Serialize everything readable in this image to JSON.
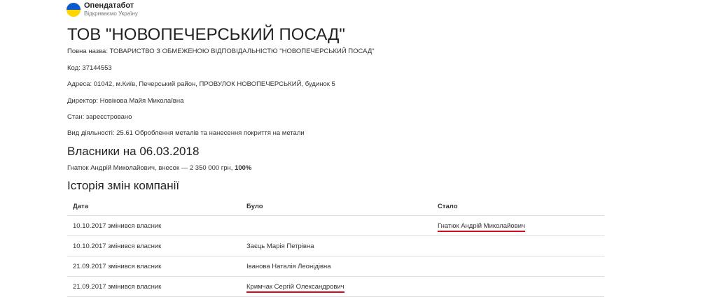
{
  "brand": {
    "name": "Опендатабот",
    "tagline": "Відкриваємо Україну"
  },
  "company": {
    "title": "ТОВ \"НОВОПЕЧЕРСЬКИЙ ПОСАД\"",
    "full_name": "Повна назва: ТОВАРИСТВО З ОБМЕЖЕНОЮ ВІДПОВІДАЛЬНІСТЮ \"НОВОПЕЧЕРСЬКИЙ ПОСАД\"",
    "code": "Код: 37144553",
    "address": "Адреса: 01042, м.Київ, Печерський район, ПРОВУЛОК НОВОПЕЧЕРСЬКИЙ, будинок 5",
    "director": "Директор: Новікова Майя Миколаївна",
    "status": "Стан: зареєстровано",
    "activity": "Вид діяльності: 25.61 Оброблення металів та нанесення покриття на метали"
  },
  "owners": {
    "title": "Власники на 06.03.2018",
    "line_text": "Гнатюк Андрій Миколайович, внесок — 2 350 000 грн, ",
    "share": "100%"
  },
  "history": {
    "title": "Історія змін компанії",
    "columns": [
      "Дата",
      "Було",
      "Стало"
    ],
    "rows": [
      {
        "date": "10.10.2017 змінився власник",
        "was": "",
        "became": "Гнатюк Андрій Миколайович"
      },
      {
        "date": "10.10.2017 змінився власник",
        "was": "Заєць Марія Петрівна",
        "became": ""
      },
      {
        "date": "21.09.2017 змінився власник",
        "was": "Іванова Наталія Леонідівна",
        "became": ""
      },
      {
        "date": "21.09.2017 змінився власник",
        "was": "Кримчак Сергій Олександрович",
        "became": ""
      }
    ]
  },
  "colors": {
    "underline": "#d40b1d",
    "logo_top": "#0a57d0",
    "logo_bottom": "#ffd500"
  }
}
